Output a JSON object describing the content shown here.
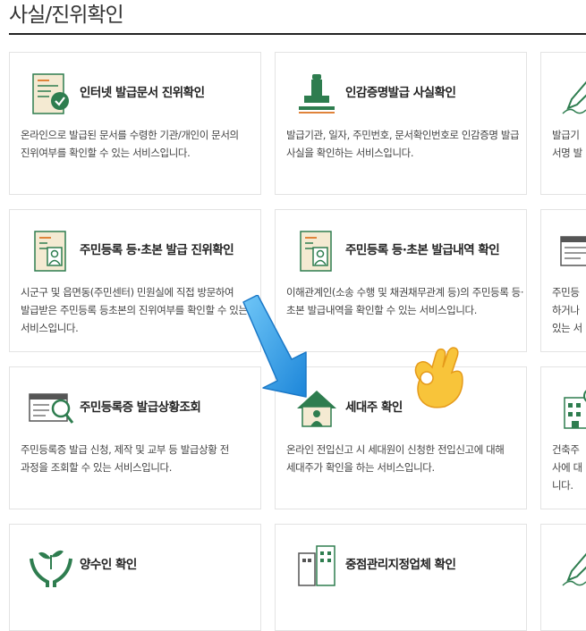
{
  "page": {
    "title": "사실/진위확인"
  },
  "colors": {
    "accent": "#2e7d4f",
    "icon_cream": "#f4ead2",
    "arrow_blue": "#2f9be6"
  },
  "cards": [
    {
      "icon": "document-check-icon",
      "title": "인터넷 발급문서 진위확인",
      "desc": "온라인으로 발급된 문서를 수령한 기관/개인이 문서의 진위여부를 확인할 수 있는 서비스입니다."
    },
    {
      "icon": "stamp-icon",
      "title": "인감증명발급 사실확인",
      "desc": "발급기관, 일자, 주민번호, 문서확인번호로 인감증명 발급 사실을 확인하는 서비스입니다."
    },
    {
      "icon": "pen-sign-icon",
      "title": "",
      "desc": "발급기\n서명 발"
    },
    {
      "icon": "resident-doc-icon",
      "title": "주민등록 등·초본 발급 진위확인",
      "desc": "시군구 및 읍면동(주민센터) 민원실에 직접 방문하여 발급받은 주민등록 등초본의 진위여부를 확인할 수 있는 서비스입니다."
    },
    {
      "icon": "resident-doc-icon",
      "title": "주민등록 등·초본 발급내역 확인",
      "desc": "이해관계인(소송 수행 및 채권채무관계 등)의 주민등록 등·초본 발급내역을 확인할 수 있는 서비스입니다."
    },
    {
      "icon": "id-card-icon",
      "title": "",
      "desc": "주민등\n하거나\n있는 서"
    },
    {
      "icon": "id-card-search-icon",
      "title": "주민등록증 발급상황조회",
      "desc": "주민등록증 발급 신청, 제작 및 교부 등 발급상황 전 과정을 조회할 수 있는 서비스입니다."
    },
    {
      "icon": "house-person-icon",
      "title": "세대주 확인",
      "desc": "온라인 전입신고 시 세대원이 신청한 전입신고에 대해 세대주가 확인을 하는 서비스입니다."
    },
    {
      "icon": "building-check-icon",
      "title": "",
      "desc": "건축주\n사에 대\n니다."
    },
    {
      "icon": "hands-sprout-icon",
      "title": "양수인 확인",
      "desc": ""
    },
    {
      "icon": "building-icon",
      "title": "중점관리지정업체 확인",
      "desc": ""
    },
    {
      "icon": "pen-sign-icon",
      "title": "",
      "desc": ""
    }
  ]
}
